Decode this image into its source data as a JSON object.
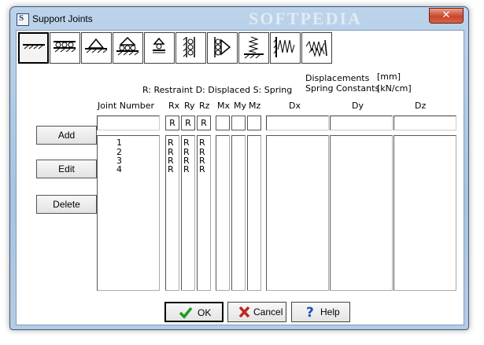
{
  "window": {
    "title": "Support Joints",
    "watermark": "SOFTPEDIA",
    "close_glyph": "✕"
  },
  "toolbar": {
    "buttons": [
      {
        "name": "fixed-support-icon",
        "pressed": true
      },
      {
        "name": "roller-x-support-icon",
        "pressed": false
      },
      {
        "name": "pin-support-icon",
        "pressed": false
      },
      {
        "name": "pinned-roller-support-icon",
        "pressed": false
      },
      {
        "name": "roller-y-support-icon",
        "pressed": false
      },
      {
        "name": "vertical-fixed-support-icon",
        "pressed": false
      },
      {
        "name": "vertical-roller-support-icon",
        "pressed": false
      },
      {
        "name": "spring-support-icon",
        "pressed": false
      },
      {
        "name": "vertical-spring-support-icon",
        "pressed": false
      },
      {
        "name": "rotational-spring-support-icon",
        "pressed": false
      }
    ]
  },
  "legend": {
    "codes": "R: Restraint  D: Displaced  S: Spring",
    "displacements": "Displacements",
    "displacements_unit": "[mm]",
    "spring_constants": "Spring Constants",
    "spring_constants_unit": "[kN/cm]"
  },
  "columns": {
    "joint_number": "Joint Number",
    "rx": "Rx",
    "ry": "Ry",
    "rz": "Rz",
    "mx": "Mx",
    "my": "My",
    "mz": "Mz",
    "dx": "Dx",
    "dy": "Dy",
    "dz": "Dz"
  },
  "edit_row": {
    "rx": "R",
    "ry": "R",
    "rz": "R"
  },
  "rows": [
    {
      "joint": "1",
      "rx": "R",
      "ry": "R",
      "rz": "R"
    },
    {
      "joint": "2",
      "rx": "R",
      "ry": "R",
      "rz": "R"
    },
    {
      "joint": "3",
      "rx": "R",
      "ry": "R",
      "rz": "R"
    },
    {
      "joint": "4",
      "rx": "R",
      "ry": "R",
      "rz": "R"
    }
  ],
  "side_buttons": {
    "add": "Add",
    "edit": "Edit",
    "delete": "Delete"
  },
  "bottom_buttons": {
    "ok": "OK",
    "cancel": "Cancel",
    "help": "Help"
  },
  "colors": {
    "ok_check": "#1f9a1f",
    "cancel_x": "#c0261c",
    "help_q": "#1b4fbf"
  }
}
